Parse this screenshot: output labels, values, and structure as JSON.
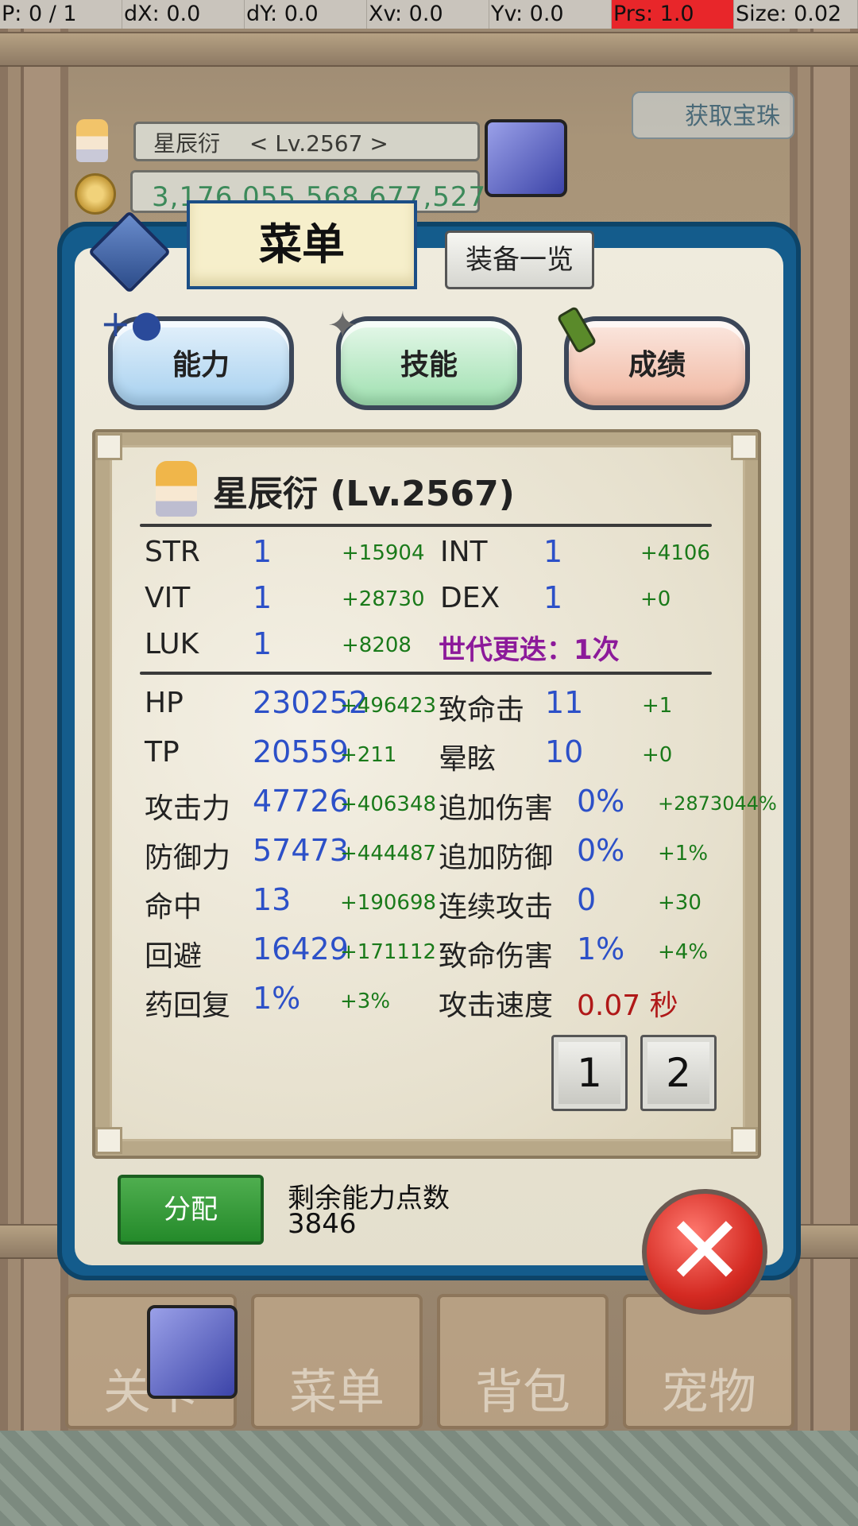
{
  "debug": {
    "p": "P: 0 / 1",
    "dx": "dX: 0.0",
    "dy": "dY: 0.0",
    "xv": "Xv: 0.0",
    "yv": "Yv: 0.0",
    "prs": "Prs: 1.0",
    "size": "Size: 0.02"
  },
  "hud": {
    "name": "星辰衍 　< Lv.2567 >",
    "gold": "3,176,055,568,677,527",
    "treasure_label": "获取宝珠"
  },
  "panel": {
    "tab_menu": "菜单",
    "tab_equip": "装备一览",
    "categories": [
      {
        "label": "能力",
        "icon": "person-plus-icon"
      },
      {
        "label": "技能",
        "icon": "sparkle-icon"
      },
      {
        "label": "成绩",
        "icon": "scroll-icon"
      }
    ],
    "character_title": "星辰衍 (Lv.2567)",
    "base_stats": [
      {
        "name": "STR",
        "value": "1",
        "bonus": "+15904"
      },
      {
        "name": "INT",
        "value": "1",
        "bonus": "+4106"
      },
      {
        "name": "VIT",
        "value": "1",
        "bonus": "+28730"
      },
      {
        "name": "DEX",
        "value": "1",
        "bonus": "+0"
      },
      {
        "name": "LUK",
        "value": "1",
        "bonus": "+8208"
      }
    ],
    "generation": "世代更迭：1次",
    "left_stats": [
      {
        "name": "HP",
        "value": "230252",
        "bonus": "+496423"
      },
      {
        "name": "TP",
        "value": "20559",
        "bonus": "+211"
      },
      {
        "name": "攻击力",
        "value": "47726",
        "bonus": "+406348"
      },
      {
        "name": "防御力",
        "value": "57473",
        "bonus": "+444487"
      },
      {
        "name": "命中",
        "value": "13",
        "bonus": "+190698"
      },
      {
        "name": "回避",
        "value": "16429",
        "bonus": "+171112"
      },
      {
        "name": "药回复",
        "value": "1%",
        "bonus": "+3%"
      }
    ],
    "right_stats": [
      {
        "name": "致命击",
        "value": "11",
        "bonus": "+1"
      },
      {
        "name": "晕眩",
        "value": "10",
        "bonus": "+0"
      },
      {
        "name": "追加伤害",
        "value": "0%",
        "bonus": "+2873044%"
      },
      {
        "name": "追加防御",
        "value": "0%",
        "bonus": "+1%"
      },
      {
        "name": "连续攻击",
        "value": "0",
        "bonus": "+30"
      },
      {
        "name": "致命伤害",
        "value": "1%",
        "bonus": "+4%"
      },
      {
        "name": "攻击速度",
        "value": "0.07 秒",
        "bonus": ""
      }
    ],
    "pages": [
      "1",
      "2"
    ],
    "assign_label": "分配",
    "remaining_label": "剩余能力点数",
    "remaining_value": "3846",
    "close_glyph": "✕"
  },
  "nav": [
    "关卡",
    "菜单",
    "背包",
    "宠物"
  ],
  "colors": {
    "frame_blue": "#145c8c",
    "stat_value": "#2c50c8",
    "stat_bonus": "#1a7a1a",
    "generation": "#8c1a9a",
    "speed": "#b01818",
    "assign_green": "#248a2a",
    "close_red": "#d42a22"
  }
}
